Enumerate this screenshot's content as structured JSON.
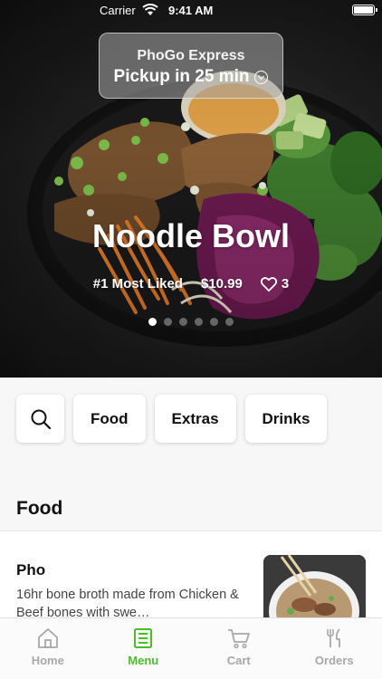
{
  "status_bar": {
    "carrier": "Carrier",
    "time": "9:41 AM"
  },
  "pickup": {
    "store": "PhoGo Express",
    "label": "Pickup in 25 min"
  },
  "hero": {
    "title": "Noodle Bowl",
    "badge": "#1 Most Liked",
    "price": "$10.99",
    "likes": "3",
    "carousel": {
      "pages": 6,
      "active_index": 0
    }
  },
  "categories": {
    "items": [
      "Food",
      "Extras",
      "Drinks"
    ]
  },
  "section": {
    "title": "Food"
  },
  "menu_item": {
    "name": "Pho",
    "description": "16hr bone broth made from Chicken & Beef bones with swe…"
  },
  "tabbar": {
    "items": [
      {
        "label": "Home",
        "icon": "home-icon"
      },
      {
        "label": "Menu",
        "icon": "menu-icon"
      },
      {
        "label": "Cart",
        "icon": "cart-icon"
      },
      {
        "label": "Orders",
        "icon": "fork-knife-icon"
      }
    ],
    "active_index": 1
  },
  "colors": {
    "accent": "#4cbd2a",
    "inactive": "#a8a8a8"
  }
}
